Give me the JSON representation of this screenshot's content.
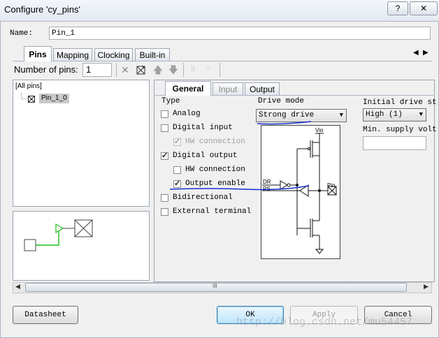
{
  "window": {
    "title": "Configure 'cy_pins'",
    "help_label": "?",
    "close_label": "✕"
  },
  "name": {
    "label": "Name:",
    "value": "Pin_1"
  },
  "tabs": [
    {
      "label": "Pins"
    },
    {
      "label": "Mapping"
    },
    {
      "label": "Clocking"
    },
    {
      "label": "Built-in"
    }
  ],
  "tab_scroll": {
    "left": "◀",
    "right": "▶"
  },
  "toolbar": {
    "num_pins_label": "Number of pins:",
    "num_pins_value": "1"
  },
  "tree": {
    "root": "[All pins]",
    "child": "Pin_1_0"
  },
  "inner_tabs": [
    {
      "label": "General"
    },
    {
      "label": "Input"
    },
    {
      "label": "Output"
    }
  ],
  "type": {
    "label": "Type",
    "options": [
      {
        "label": "Analog",
        "checked": false,
        "disabled": false
      },
      {
        "label": "Digital input",
        "checked": false,
        "disabled": false
      },
      {
        "label": "HW connection",
        "checked": true,
        "disabled": true
      },
      {
        "label": "Digital output",
        "checked": true,
        "disabled": false
      },
      {
        "label": "HW connection",
        "checked": false,
        "disabled": false
      },
      {
        "label": "Output enable",
        "checked": true,
        "disabled": false
      },
      {
        "label": "Bidirectional",
        "checked": false,
        "disabled": false
      },
      {
        "label": "External terminal",
        "checked": false,
        "disabled": false
      }
    ]
  },
  "drive_mode": {
    "label": "Drive mode",
    "value": "Strong drive"
  },
  "schematic": {
    "vio": "Vio",
    "dr": "DR",
    "ps": "PS",
    "pin": "Pin"
  },
  "initial_drive": {
    "label": "Initial drive st",
    "value": "High (1)",
    "min_supply_label": "Min. supply volt",
    "min_supply_value": ""
  },
  "scrollbar": {
    "grip": "III"
  },
  "buttons": {
    "datasheet": "Datasheet",
    "ok": "OK",
    "apply": "Apply",
    "cancel": "Cancel"
  },
  "watermark": "http://blog.csdn.net/mu54457",
  "colors": {
    "annotation_blue": "#1a2fd0",
    "wire_green": "#22c022"
  }
}
